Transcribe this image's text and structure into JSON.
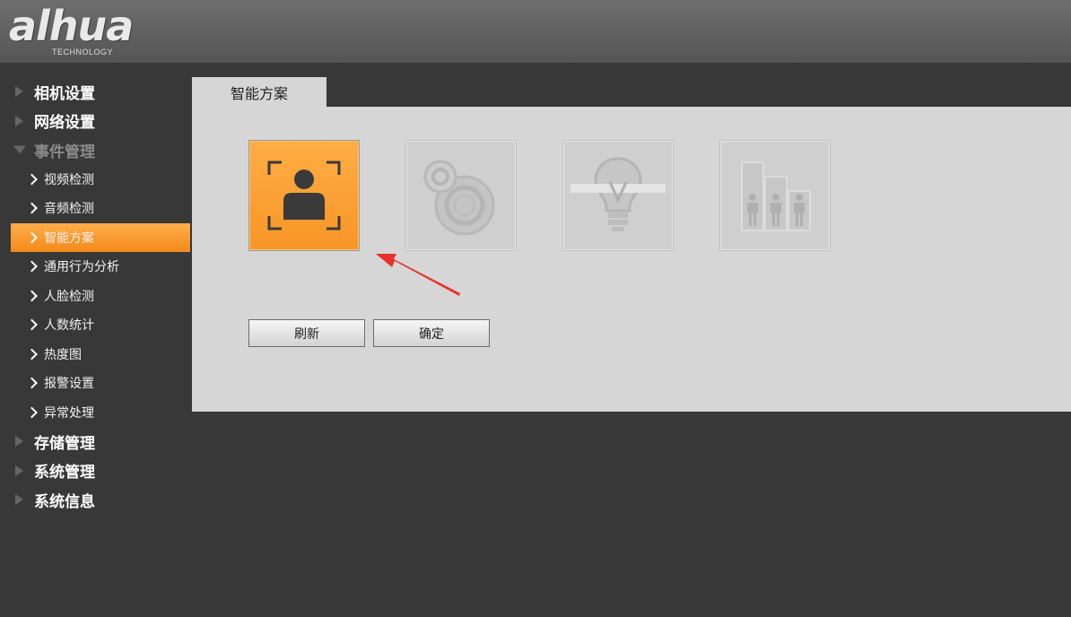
{
  "header": {
    "logo_text": "alhua",
    "logo_sub": "TECHNOLOGY"
  },
  "sidebar": {
    "items": [
      {
        "label": "相机设置",
        "level": "top",
        "expanded": false
      },
      {
        "label": "网络设置",
        "level": "top",
        "expanded": false
      },
      {
        "label": "事件管理",
        "level": "top",
        "expanded": true
      },
      {
        "label": "视频检测",
        "level": "sub"
      },
      {
        "label": "音频检测",
        "level": "sub"
      },
      {
        "label": "智能方案",
        "level": "sub",
        "active": true
      },
      {
        "label": "通用行为分析",
        "level": "sub"
      },
      {
        "label": "人脸检测",
        "level": "sub"
      },
      {
        "label": "人数统计",
        "level": "sub"
      },
      {
        "label": "热度图",
        "level": "sub"
      },
      {
        "label": "报警设置",
        "level": "sub"
      },
      {
        "label": "异常处理",
        "level": "sub"
      },
      {
        "label": "存储管理",
        "level": "top",
        "expanded": false
      },
      {
        "label": "系统管理",
        "level": "top",
        "expanded": false
      },
      {
        "label": "系统信息",
        "level": "top",
        "expanded": false
      }
    ]
  },
  "main": {
    "tab_label": "智能方案",
    "plans": [
      {
        "icon": "face-detection-icon",
        "selected": true
      },
      {
        "icon": "behavior-analysis-icon",
        "selected": false
      },
      {
        "icon": "lightbulb-icon",
        "selected": false
      },
      {
        "icon": "people-counting-icon",
        "selected": false
      }
    ],
    "buttons": {
      "refresh_label": "刷新",
      "confirm_label": "确定"
    }
  },
  "colors": {
    "accent": "#f79526",
    "annotation_arrow": "#e8312a"
  }
}
